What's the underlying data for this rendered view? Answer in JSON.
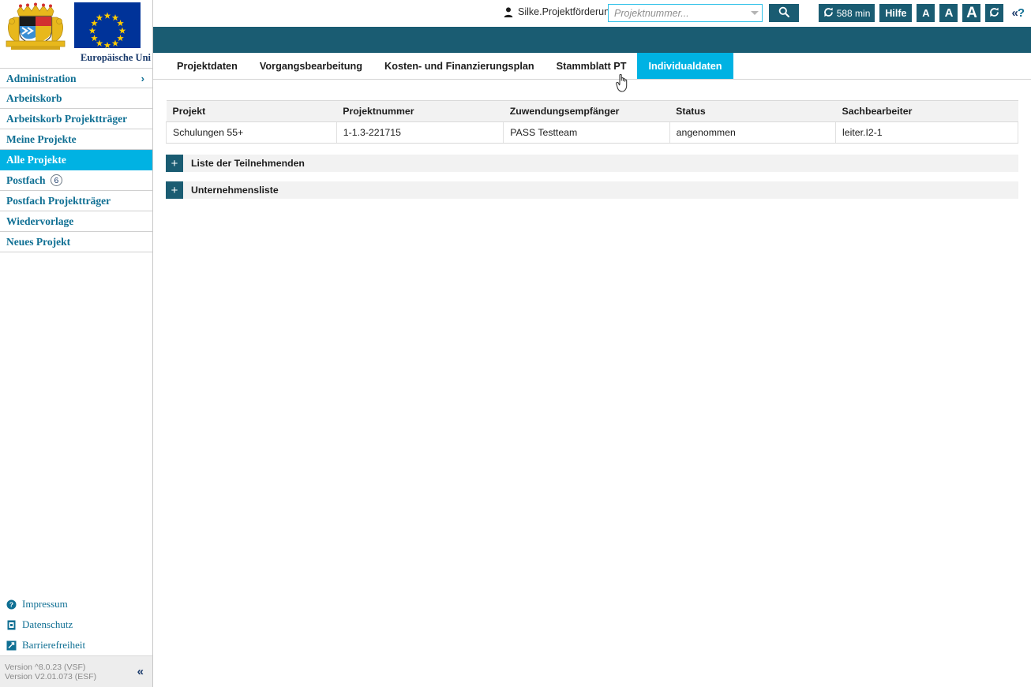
{
  "header": {
    "user_name": "Silke.Projektförderung",
    "user_icon": "person-icon",
    "search_placeholder": "Projektnummer...",
    "search_value": "",
    "search_button_icon": "search-icon",
    "session_timer": "588 min",
    "session_timer_icon": "refresh-icon",
    "help_label": "Hilfe",
    "font_small": "A",
    "font_medium": "A",
    "font_large": "A",
    "reload_icon": "refresh-icon",
    "help_toggle": "«?",
    "accent_teal": "#1a5c72",
    "accent_cyan": "#00b2e3"
  },
  "sidebar": {
    "crest_alt": "bayern-wappen-icon",
    "eu_flag_alt": "eu-flag-icon",
    "eu_caption": "Europäische Uni",
    "items": [
      {
        "label": "Administration",
        "active": false,
        "chevron": "›",
        "badge": ""
      },
      {
        "label": "Arbeitskorb",
        "active": false,
        "chevron": "",
        "badge": ""
      },
      {
        "label": "Arbeitskorb Projektträger",
        "active": false,
        "chevron": "",
        "badge": ""
      },
      {
        "label": "Meine Projekte",
        "active": false,
        "chevron": "",
        "badge": ""
      },
      {
        "label": "Alle Projekte",
        "active": true,
        "chevron": "",
        "badge": ""
      },
      {
        "label": "Postfach",
        "active": false,
        "chevron": "",
        "badge": "6"
      },
      {
        "label": "Postfach Projektträger",
        "active": false,
        "chevron": "",
        "badge": ""
      },
      {
        "label": "Wiedervorlage",
        "active": false,
        "chevron": "",
        "badge": ""
      },
      {
        "label": "Neues Projekt",
        "active": false,
        "chevron": "",
        "badge": ""
      }
    ],
    "links": [
      {
        "label": "Impressum",
        "icon": "question-circle-icon"
      },
      {
        "label": "Datenschutz",
        "icon": "document-shield-icon"
      },
      {
        "label": "Barrierefreiheit",
        "icon": "accessibility-icon"
      }
    ],
    "version": "Version ^8.0.23 (VSF)\nVersion V2.01.073 (ESF)",
    "collapse_icon": "«"
  },
  "tabs": [
    {
      "label": "Projektdaten",
      "active": false
    },
    {
      "label": "Vorgangsbearbeitung",
      "active": false
    },
    {
      "label": "Kosten- und Finanzierungsplan",
      "active": false
    },
    {
      "label": "Stammblatt PT",
      "active": false
    },
    {
      "label": "Individualdaten",
      "active": true
    }
  ],
  "project_table": {
    "columns": [
      "Projekt",
      "Projektnummer",
      "Zuwendungsempfänger",
      "Status",
      "Sachbearbeiter"
    ],
    "rows": [
      [
        "Schulungen 55+",
        "1-1.3-221715",
        "PASS Testteam",
        "angenommen",
        "leiter.I2-1"
      ]
    ]
  },
  "accordions": [
    {
      "label": "Liste der Teilnehmenden",
      "toggle": "+"
    },
    {
      "label": "Unternehmensliste",
      "toggle": "+"
    }
  ]
}
